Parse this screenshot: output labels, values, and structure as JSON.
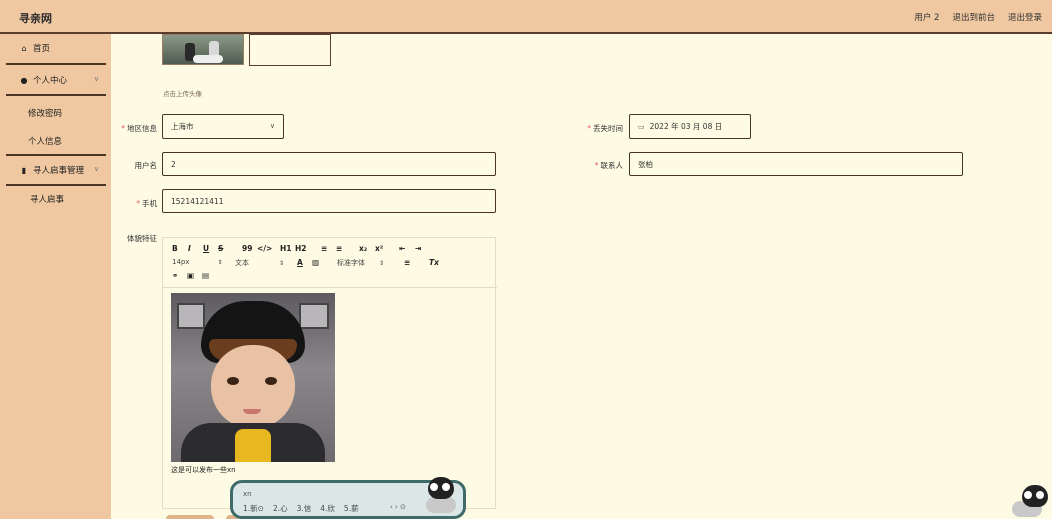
{
  "header": {
    "logo": "寻亲网",
    "links": [
      "用户 2",
      "退出到前台",
      "退出登录"
    ]
  },
  "sidebar": {
    "home": "首页",
    "personal_center": "个人中心",
    "change_password": "修改密码",
    "personal_info": "个人信息",
    "notice_management": "寻人启事管理",
    "notice": "寻人启事"
  },
  "form": {
    "upload_hint": "点击上传头像",
    "region_label": "地区信息",
    "region_value": "上海市",
    "lost_time_label": "丢失时间",
    "lost_time_value": "2022 年 03 月 08 日",
    "username_label": "用户名",
    "username_value": "2",
    "contact_label": "联系人",
    "contact_value": "张柏",
    "phone_label": "手机",
    "phone_value": "15214121411",
    "features_label": "体貌特征",
    "editor_text": "这是可以发布一些xn"
  },
  "editor_toolbar": {
    "font_size": "14px",
    "text_style": "文本",
    "font_family": "标准字体",
    "buttons_row1": [
      "B",
      "I",
      "U",
      "S",
      "99",
      "</>",
      "H1",
      "H2",
      "≡",
      "≡",
      "x₂",
      "x²",
      "⇤",
      "⇥"
    ],
    "buttons_row2": [
      "A",
      "▨",
      "≡",
      "Tx"
    ]
  },
  "ime": {
    "input": "xn",
    "candidates": [
      "1.新⊙",
      "2.心",
      "3.信",
      "4.欣",
      "5.薪"
    ]
  }
}
